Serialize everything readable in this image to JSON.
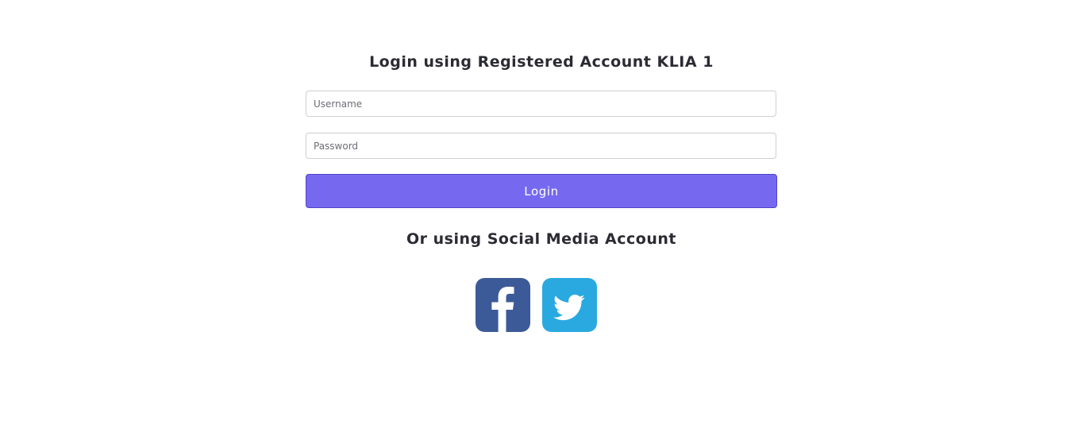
{
  "login": {
    "title": "Login using Registered Account KLIA 1",
    "username_placeholder": "Username",
    "password_placeholder": "Password",
    "button_label": "Login"
  },
  "social": {
    "title": "Or using Social Media Account",
    "buttons": [
      {
        "icon": "facebook-icon",
        "color": "#3d5a98"
      },
      {
        "icon": "twitter-icon",
        "color": "#2aa9e0"
      }
    ]
  },
  "colors": {
    "accent": "#7669f0",
    "facebook": "#3d5a98",
    "twitter": "#2aa9e0"
  }
}
